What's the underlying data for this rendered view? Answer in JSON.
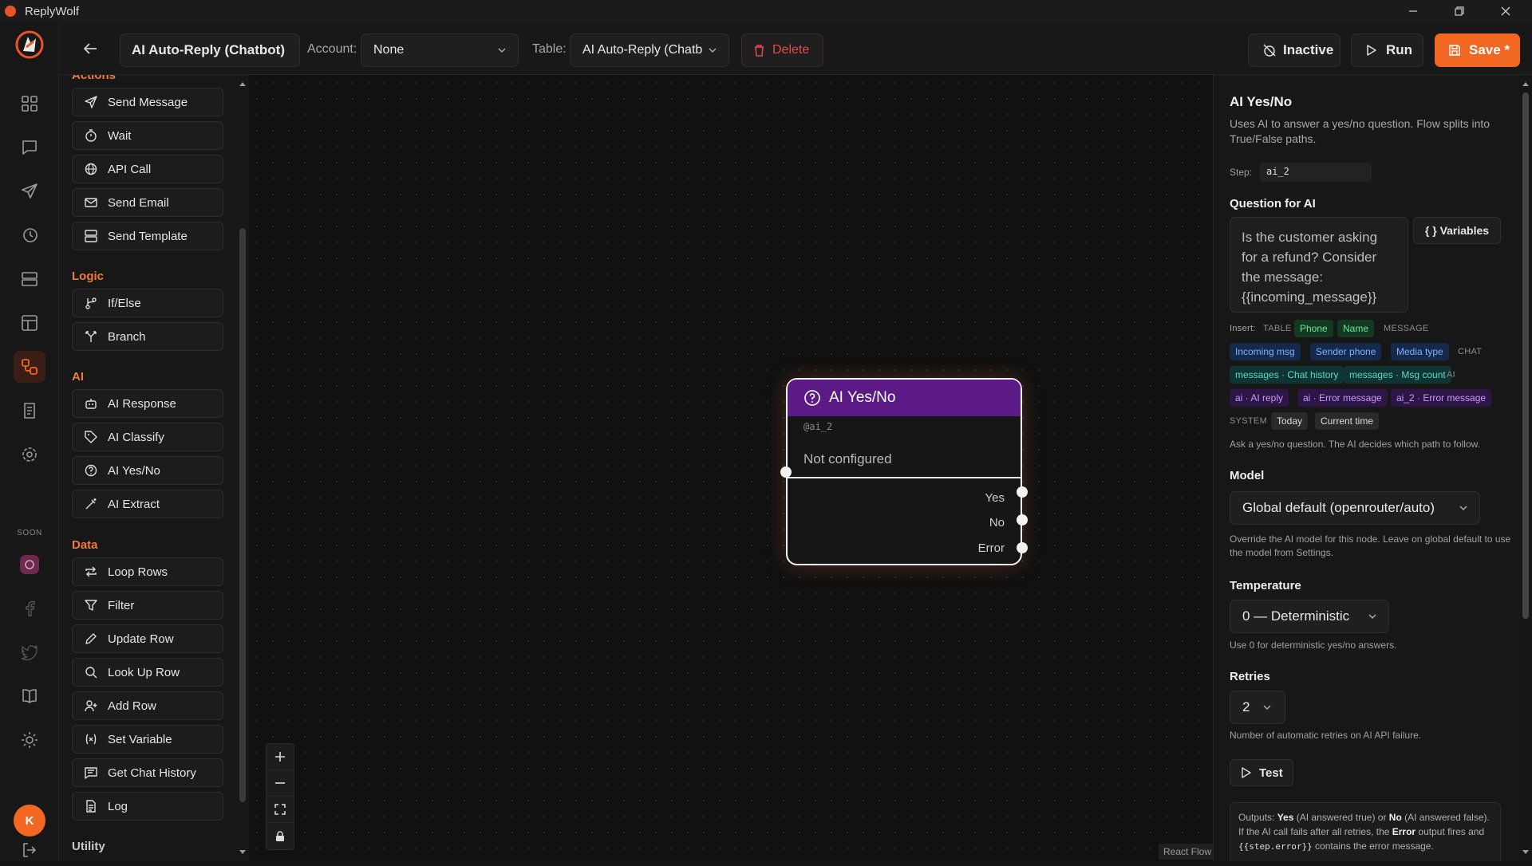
{
  "window": {
    "title": "ReplyWolf"
  },
  "toolbar": {
    "flow_name": "AI Auto-Reply (Chatbot)",
    "account_label": "Account:",
    "account_value": "None",
    "table_label": "Table:",
    "table_value": "AI Auto-Reply (Chatb",
    "delete_label": "Delete",
    "inactive_label": "Inactive",
    "run_label": "Run",
    "save_label": "Save *"
  },
  "rail": {
    "soon_label": "SOON",
    "avatar_initial": "K"
  },
  "palette": {
    "actions_label": "Actions",
    "actions": [
      "Send Message",
      "Wait",
      "API Call",
      "Send Email",
      "Send Template"
    ],
    "logic_label": "Logic",
    "logic": [
      "If/Else",
      "Branch"
    ],
    "ai_label": "AI",
    "ai": [
      "AI Response",
      "AI Classify",
      "AI Yes/No",
      "AI Extract"
    ],
    "data_label": "Data",
    "data": [
      "Loop Rows",
      "Filter",
      "Update Row",
      "Look Up Row",
      "Add Row",
      "Set Variable",
      "Get Chat History",
      "Log"
    ],
    "utility_label": "Utility"
  },
  "node": {
    "title": "AI Yes/No",
    "id": "@ai_2",
    "status": "Not configured",
    "outputs": [
      "Yes",
      "No",
      "Error"
    ]
  },
  "canvas": {
    "attribution": "React Flow"
  },
  "panel": {
    "title": "AI Yes/No",
    "description": "Uses AI to answer a yes/no question. Flow splits into True/False paths.",
    "step_label": "Step:",
    "step_value": "ai_2",
    "question_heading": "Question for AI",
    "question_value": "Is the customer asking for a refund? Consider the message: {{incoming_message}}",
    "variables_button": "{ } Variables",
    "insert_label": "Insert:",
    "groups": {
      "table": "TABLE",
      "message": "MESSAGE",
      "chat": "CHAT",
      "ai": "AI",
      "system": "SYSTEM"
    },
    "chips": {
      "table": [
        "Phone",
        "Name"
      ],
      "message": [
        "Incoming msg",
        "Sender phone",
        "Media type"
      ],
      "chat": [
        "messages · Chat history",
        "messages · Msg count"
      ],
      "ai": [
        "ai · AI reply",
        "ai · Error message",
        "ai_2 · Error message"
      ],
      "system": [
        "Today",
        "Current time"
      ]
    },
    "question_help": "Ask a yes/no question. The AI decides which path to follow.",
    "model_heading": "Model",
    "model_value": "Global default (openrouter/auto)",
    "model_help": "Override the AI model for this node. Leave on global default to use the model from Settings.",
    "temperature_heading": "Temperature",
    "temperature_value": "0 — Deterministic",
    "temperature_help": "Use 0 for deterministic yes/no answers.",
    "retries_heading": "Retries",
    "retries_value": "2",
    "retries_help": "Number of automatic retries on AI API failure.",
    "test_button": "Test",
    "outputs_prefix": "Outputs: ",
    "outputs_yes": "Yes",
    "outputs_mid1": " (AI answered true) or ",
    "outputs_no": "No",
    "outputs_mid2": " (AI answered false). If the AI call fails after all retries, the ",
    "outputs_error": "Error",
    "outputs_mid3": " output fires and ",
    "outputs_code": "{{step.error}}",
    "outputs_suffix": " contains the error message."
  },
  "colors": {
    "accent": "#f26722",
    "node_header": "#5b1a86",
    "delete": "#e5484d"
  }
}
